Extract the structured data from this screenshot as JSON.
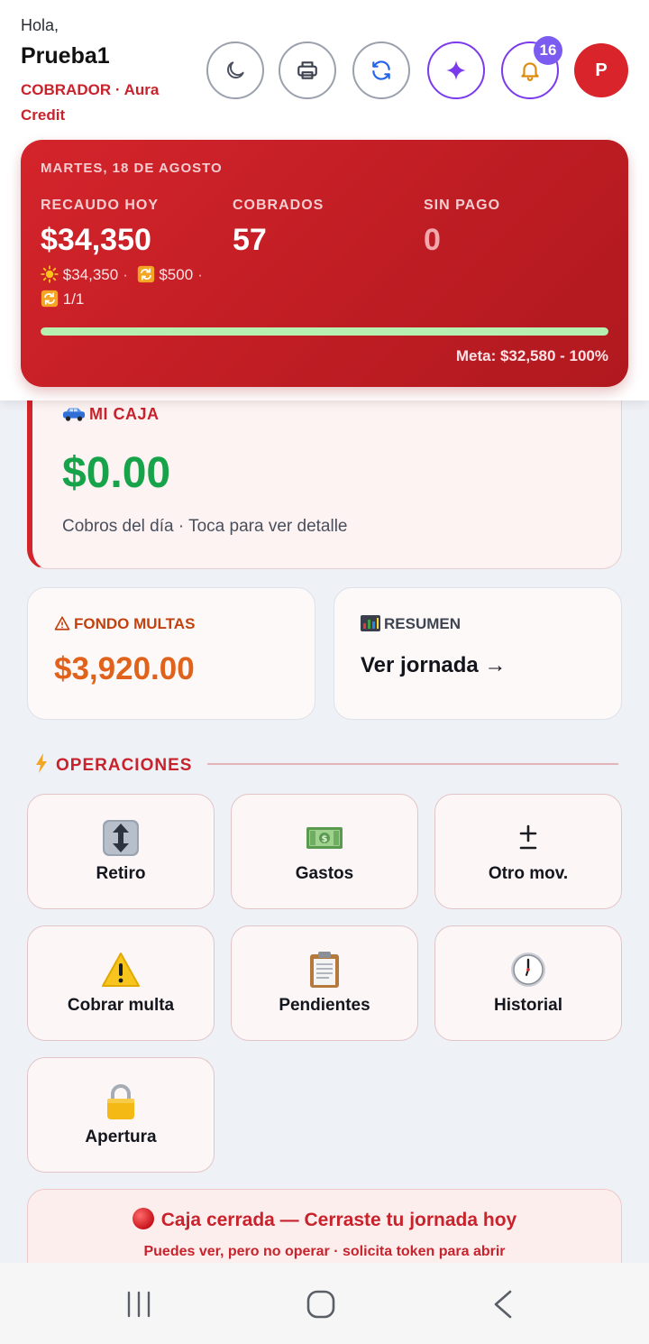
{
  "header": {
    "greeting": "Hola,",
    "user_name": "Prueba1",
    "role_line": "COBRADOR · Aura Credit",
    "notification_count": "16",
    "avatar_initial": "P",
    "icons": [
      "moon-icon",
      "printer-icon",
      "refresh-icon",
      "sparkle-icon",
      "bell-icon"
    ]
  },
  "summary": {
    "date": "MARTES, 18 DE AGOSTO",
    "recaudo_label": "RECAUDO HOY",
    "recaudo_value": "$34,350",
    "cobrados_label": "COBRADOS",
    "cobrados_value": "57",
    "sinpago_label": "SIN PAGO",
    "sinpago_value": "0",
    "detail_sun": "$34,350",
    "detail_repeat": "$500",
    "detail_ratio": "1/1",
    "progress_fraction": 1.0,
    "meta": "Meta: $32,580 - 100%"
  },
  "caja": {
    "title": "MI CAJA",
    "value": "$0.00",
    "subtitle": "Cobros del día · Toca para ver detalle"
  },
  "fondo": {
    "title": "FONDO MULTAS",
    "value": "$3,920.00"
  },
  "resumen": {
    "title": "RESUMEN",
    "link": "Ver jornada →"
  },
  "operaciones": {
    "title": "OPERACIONES",
    "items": [
      {
        "label": "Retiro",
        "icon": "updown-arrow-icon"
      },
      {
        "label": "Gastos",
        "icon": "money-icon"
      },
      {
        "label": "Otro mov.",
        "icon": "plus-minus-icon"
      },
      {
        "label": "Cobrar multa",
        "icon": "warning-icon"
      },
      {
        "label": "Pendientes",
        "icon": "clipboard-icon"
      },
      {
        "label": "Historial",
        "icon": "clock-icon"
      },
      {
        "label": "Apertura",
        "icon": "lock-icon"
      }
    ]
  },
  "banner": {
    "title": "Caja cerrada — Cerraste tu jornada hoy",
    "subtitle": "Puedes ver, pero no operar · solicita token para abrir"
  },
  "colors": {
    "brand_red": "#d4242b",
    "money_green": "#17a34a",
    "fine_orange": "#e0621b",
    "accent_purple": "#7c3aed",
    "progress_green": "#b7efb0"
  }
}
